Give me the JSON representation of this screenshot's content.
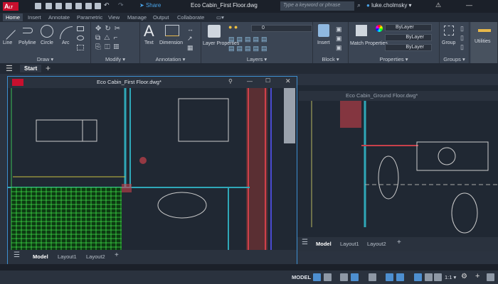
{
  "app": {
    "logo": "A",
    "badge": "LT",
    "share": "Share",
    "doc_title": "Eco Cabin_First Floor.dwg",
    "search_placeholder": "Type a keyword or phrase",
    "user": "luke.cholmsky"
  },
  "ribbon_tabs": [
    "Home",
    "Insert",
    "Annotate",
    "Parametric",
    "View",
    "Manage",
    "Output",
    "Collaborate"
  ],
  "panels": {
    "draw": {
      "label": "Draw",
      "buttons": [
        "Line",
        "Polyline",
        "Circle",
        "Arc"
      ]
    },
    "modify": {
      "label": "Modify"
    },
    "annotation": {
      "label": "Annotation",
      "buttons": [
        "Text",
        "Dimension"
      ]
    },
    "layers": {
      "label": "Layers",
      "button": "Layer Properties",
      "current_layer": "0"
    },
    "block": {
      "label": "Block",
      "button": "Insert"
    },
    "properties": {
      "label": "Properties",
      "button": "Match Properties",
      "color": "ByLayer",
      "linetype": "ByLayer",
      "lineweight": "ByLayer"
    },
    "groups": {
      "label": "Groups",
      "button": "Group"
    },
    "utilities": {
      "label": "Utilities"
    }
  },
  "file_tabs": {
    "start": "Start"
  },
  "floating_window": {
    "title": "Eco Cabin_First Floor.dwg*",
    "layout_tabs": [
      "Model",
      "Layout1",
      "Layout2"
    ]
  },
  "background_window": {
    "title": "Eco Cabin_Ground Floor.dwg*",
    "layout_tabs": [
      "Model",
      "Layout1",
      "Layout2"
    ]
  },
  "status_bar": {
    "model": "MODEL",
    "scale": "1:1"
  },
  "colors": {
    "accent": "#3d8fd1",
    "brand": "#c8102e",
    "canvas": "#202833"
  }
}
